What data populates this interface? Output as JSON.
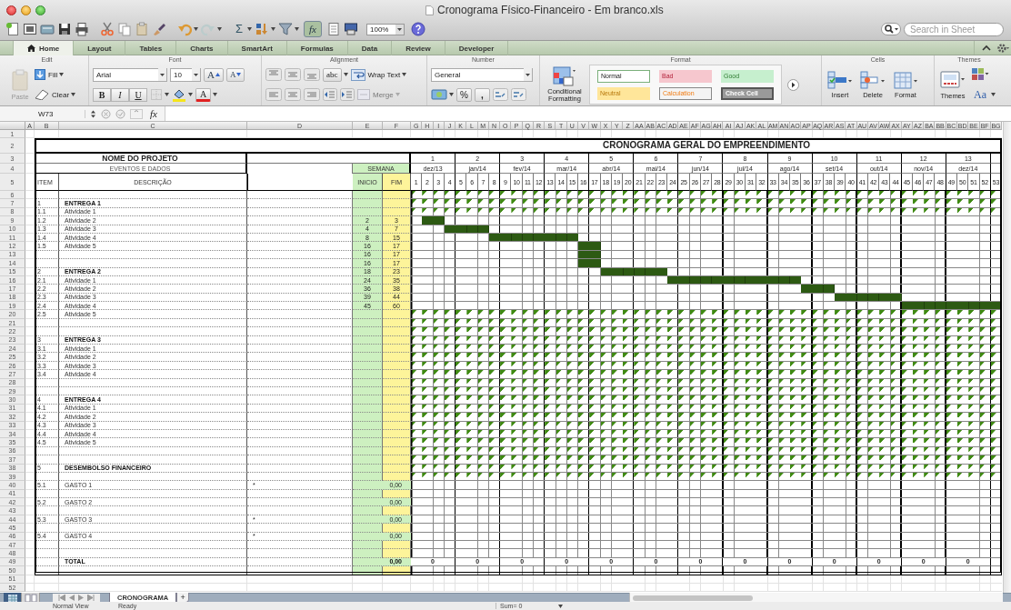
{
  "window": {
    "title": "Cronograma Físico-Financeiro - Em branco.xls"
  },
  "toolbar": {
    "sum": "Σ",
    "formula_builder": "fx",
    "zoom": "100%"
  },
  "search": {
    "placeholder": "Search in Sheet"
  },
  "tabs": [
    {
      "label": "Home",
      "selected": true
    },
    {
      "label": "Layout",
      "selected": false
    },
    {
      "label": "Tables",
      "selected": false
    },
    {
      "label": "Charts",
      "selected": false
    },
    {
      "label": "SmartArt",
      "selected": false
    },
    {
      "label": "Formulas",
      "selected": false
    },
    {
      "label": "Data",
      "selected": false
    },
    {
      "label": "Review",
      "selected": false
    },
    {
      "label": "Developer",
      "selected": false
    }
  ],
  "ribbon": {
    "edit": {
      "title": "Edit",
      "paste": {
        "label": "Paste",
        "disabled": true
      },
      "fill": "Fill",
      "clear": "Clear"
    },
    "font": {
      "title": "Font",
      "name": "Arial",
      "size": "10",
      "grow": "A",
      "shrink": "A",
      "bold": "B",
      "italic": "I",
      "underline": "U",
      "text_tint": "A"
    },
    "alignment": {
      "title": "Alignment",
      "orientation": "abc",
      "wrap": "Wrap Text",
      "merge": {
        "label": "Merge",
        "disabled": true
      }
    },
    "number": {
      "title": "Number",
      "format": "General",
      "percent": "%",
      "comma": ","
    },
    "format": {
      "title": "Format",
      "conditional": "Conditional Formatting",
      "styles": [
        {
          "label": "Normal",
          "kind": "normal"
        },
        {
          "label": "Bad",
          "kind": "bad"
        },
        {
          "label": "Good",
          "kind": "good"
        },
        {
          "label": "Neutral",
          "kind": "neutral"
        },
        {
          "label": "Calculation",
          "kind": "calculation"
        },
        {
          "label": "Check Cell",
          "kind": "check"
        }
      ]
    },
    "cells": {
      "title": "Cells",
      "buttons": [
        "Insert",
        "Delete",
        "Format"
      ]
    },
    "themes": {
      "title": "Themes",
      "button": "Themes",
      "fonts": "Aa"
    }
  },
  "formula_bar": {
    "name_box": "W73",
    "fx": "fx"
  },
  "sheet": {
    "columns": [
      "A",
      "B",
      "C",
      "D",
      "E",
      "F",
      "G",
      "H",
      "I",
      "J",
      "K",
      "L",
      "M",
      "N",
      "O",
      "P",
      "Q",
      "R",
      "S",
      "T",
      "U",
      "V",
      "W",
      "X",
      "Y",
      "Z",
      "AA",
      "AB",
      "AC",
      "AD",
      "AE",
      "AF",
      "AG",
      "AH",
      "AI",
      "AJ",
      "AK",
      "AL",
      "AM",
      "AN",
      "AO",
      "AP",
      "AQ",
      "AR",
      "AS",
      "AT",
      "AU",
      "AV",
      "AW",
      "AX",
      "AY",
      "AZ",
      "BA",
      "BB",
      "BC",
      "BD",
      "BE",
      "BF",
      "BG"
    ],
    "row_numbers": [
      "1",
      "2",
      "3",
      "4",
      "5",
      "6",
      "7",
      "8",
      "9",
      "10",
      "11",
      "12",
      "13",
      "14",
      "15",
      "16",
      "17",
      "18",
      "19",
      "20",
      "21",
      "22",
      "23",
      "24",
      "25",
      "26",
      "27",
      "28",
      "29",
      "30",
      "31",
      "32",
      "33",
      "34",
      "35",
      "36",
      "37",
      "38",
      "39",
      "40",
      "41",
      "42",
      "43",
      "44",
      "45",
      "46",
      "47",
      "48",
      "49",
      "50",
      "51",
      "52"
    ],
    "schedule_title": "CRONOGRAMA GERAL DO EMPREENDIMENTO",
    "project_title": "NOME DO PROJETO",
    "events_label": "EVENTOS E DADOS",
    "week_label": "SEMANA",
    "headers": {
      "item": "ITEM",
      "description": "DESCRIÇÃO",
      "start": "INICIO",
      "end": "FIM"
    },
    "months": [
      {
        "number": "1",
        "label": "dez/13"
      },
      {
        "number": "2",
        "label": "jan/14"
      },
      {
        "number": "3",
        "label": "fev/14"
      },
      {
        "number": "4",
        "label": "mar/14"
      },
      {
        "number": "5",
        "label": "abr/14"
      },
      {
        "number": "6",
        "label": "mai/14"
      },
      {
        "number": "7",
        "label": "jun/14"
      },
      {
        "number": "8",
        "label": "jul/14"
      },
      {
        "number": "9",
        "label": "ago/14"
      },
      {
        "number": "10",
        "label": "set/14"
      },
      {
        "number": "11",
        "label": "out/14"
      },
      {
        "number": "12",
        "label": "nov/14"
      },
      {
        "number": "13",
        "label": "dez/14"
      }
    ],
    "weeks": [
      "1",
      "2",
      "3",
      "4",
      "5",
      "6",
      "7",
      "8",
      "9",
      "10",
      "11",
      "12",
      "13",
      "14",
      "15",
      "16",
      "17",
      "18",
      "19",
      "20",
      "21",
      "22",
      "23",
      "24",
      "25",
      "26",
      "27",
      "28",
      "29",
      "30",
      "31",
      "32",
      "33",
      "34",
      "35",
      "36",
      "37",
      "38",
      "39",
      "40",
      "41",
      "42",
      "43",
      "44",
      "45",
      "46",
      "47",
      "48",
      "49",
      "50",
      "51",
      "52",
      "53"
    ],
    "rows": [
      {
        "kind": "blank",
        "flags": true
      },
      {
        "kind": "group",
        "item": "1",
        "description": "ENTREGA 1",
        "flags": true
      },
      {
        "kind": "activity",
        "item": "1.1",
        "description": "Atividade 1",
        "flags": true
      },
      {
        "kind": "activity",
        "item": "1.2",
        "description": "Atividade 2",
        "start": "2",
        "end": "3",
        "flags": false
      },
      {
        "kind": "activity",
        "item": "1.3",
        "description": "Atividade 3",
        "start": "4",
        "end": "7",
        "flags": false
      },
      {
        "kind": "activity",
        "item": "1.4",
        "description": "Atividade 4",
        "start": "8",
        "end": "15",
        "flags": false
      },
      {
        "kind": "activity",
        "item": "1.5",
        "description": "Atividade 5",
        "start": "16",
        "end": "17",
        "flags": false
      },
      {
        "kind": "blank",
        "start": "16",
        "end": "17",
        "flags": false
      },
      {
        "kind": "blank",
        "start": "16",
        "end": "17",
        "flags": false
      },
      {
        "kind": "group",
        "item": "2",
        "description": "ENTREGA 2",
        "start": "18",
        "end": "23",
        "flags": false
      },
      {
        "kind": "activity",
        "item": "2.1",
        "description": "Atividade 1",
        "start": "24",
        "end": "35",
        "flags": false
      },
      {
        "kind": "activity",
        "item": "2.2",
        "description": "Atividade 2",
        "start": "36",
        "end": "38",
        "flags": false
      },
      {
        "kind": "activity",
        "item": "2.3",
        "description": "Atividade 3",
        "start": "39",
        "end": "44",
        "flags": false
      },
      {
        "kind": "activity",
        "item": "2.4",
        "description": "Atividade 4",
        "start": "45",
        "end": "60",
        "flags": false
      },
      {
        "kind": "activity",
        "item": "2.5",
        "description": "Atividade 5",
        "flags": true
      },
      {
        "kind": "blank",
        "flags": true
      },
      {
        "kind": "blank",
        "flags": true
      },
      {
        "kind": "group",
        "item": "3",
        "description": "ENTREGA 3",
        "flags": true
      },
      {
        "kind": "activity",
        "item": "3.1",
        "description": "Atividade 1",
        "flags": true
      },
      {
        "kind": "activity",
        "item": "3.2",
        "description": "Atividade 2",
        "flags": true
      },
      {
        "kind": "activity",
        "item": "3.3",
        "description": "Atividade 3",
        "flags": true
      },
      {
        "kind": "activity",
        "item": "3.4",
        "description": "Atividade 4",
        "flags": true
      },
      {
        "kind": "blank",
        "flags": true
      },
      {
        "kind": "blank",
        "flags": true
      },
      {
        "kind": "group",
        "item": "4",
        "description": "ENTREGA 4",
        "flags": true
      },
      {
        "kind": "activity",
        "item": "4.1",
        "description": "Atividade 1",
        "flags": true
      },
      {
        "kind": "activity",
        "item": "4.2",
        "description": "Atividade 2",
        "flags": true
      },
      {
        "kind": "activity",
        "item": "4.3",
        "description": "Atividade 3",
        "flags": true
      },
      {
        "kind": "activity",
        "item": "4.4",
        "description": "Atividade 4",
        "flags": true
      },
      {
        "kind": "activity",
        "item": "4.5",
        "description": "Atividade 5",
        "flags": true
      },
      {
        "kind": "blank",
        "flags": true
      },
      {
        "kind": "blank",
        "flags": true
      },
      {
        "kind": "group",
        "item": "5",
        "description": "DESEMBOLSO FINANCEIRO",
        "flags": true
      },
      {
        "kind": "blank",
        "flags": true
      },
      {
        "kind": "cost",
        "item": "5.1",
        "description": "GASTO 1",
        "note": "*",
        "value": "0,00",
        "flags": false
      },
      {
        "kind": "blank",
        "flags": false
      },
      {
        "kind": "cost",
        "item": "5.2",
        "description": "GASTO 2",
        "value": "0,00",
        "flags": false
      },
      {
        "kind": "blank",
        "flags": false
      },
      {
        "kind": "cost",
        "item": "5.3",
        "description": "GASTO 3",
        "note": "*",
        "value": "0,00",
        "flags": false
      },
      {
        "kind": "blank",
        "flags": false
      },
      {
        "kind": "cost",
        "item": "5.4",
        "description": "GASTO 4",
        "note": "*",
        "value": "0,00",
        "flags": false
      },
      {
        "kind": "blank",
        "flags": false
      },
      {
        "kind": "blank",
        "flags": false
      },
      {
        "kind": "total",
        "description": "TOTAL",
        "value": "0,00",
        "month_totals": [
          "0",
          "0",
          "0",
          "0",
          "0",
          "0",
          "0",
          "0",
          "0",
          "0",
          "0",
          "0",
          "0"
        ],
        "flags": false
      },
      {
        "kind": "blank",
        "flags": false
      }
    ]
  },
  "sheet_tabs": [
    {
      "label": "CRONOGRAMA",
      "selected": true
    }
  ],
  "add_sheet": "+",
  "views": [
    {
      "kind": "normal",
      "selected": true
    },
    {
      "kind": "layout",
      "selected": false
    }
  ],
  "status_bar": {
    "view": "Normal View",
    "state": "Ready",
    "sum": "Sum= 0"
  }
}
